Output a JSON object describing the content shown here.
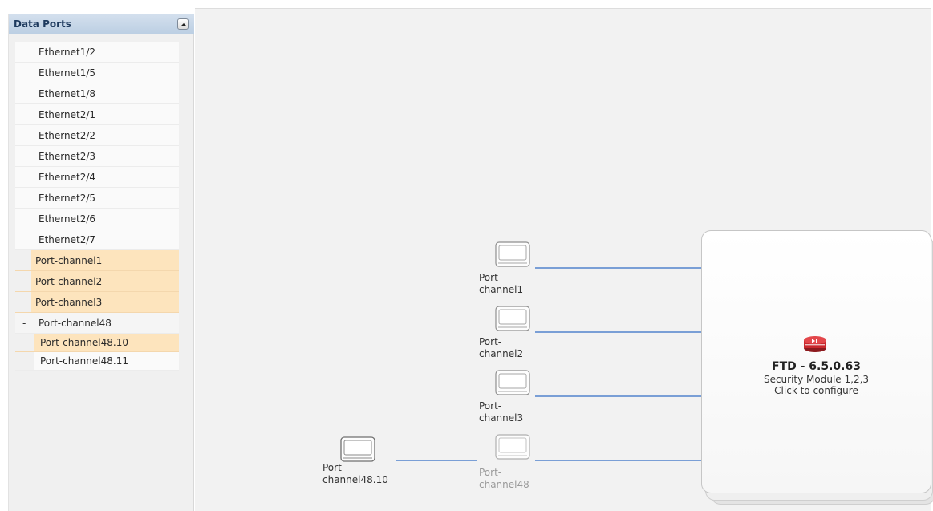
{
  "sidebar": {
    "title": "Data Ports",
    "items": [
      {
        "label": "Ethernet1/2"
      },
      {
        "label": "Ethernet1/5"
      },
      {
        "label": "Ethernet1/8"
      },
      {
        "label": "Ethernet2/1"
      },
      {
        "label": "Ethernet2/2"
      },
      {
        "label": "Ethernet2/3"
      },
      {
        "label": "Ethernet2/4"
      },
      {
        "label": "Ethernet2/5"
      },
      {
        "label": "Ethernet2/6"
      },
      {
        "label": "Ethernet2/7"
      },
      {
        "label": "Port-channel1"
      },
      {
        "label": "Port-channel2"
      },
      {
        "label": "Port-channel3"
      },
      {
        "label": "Port-channel48",
        "toggle": "-"
      },
      {
        "label": "Port-channel48.10"
      },
      {
        "label": "Port-channel48.11"
      }
    ]
  },
  "canvas": {
    "nodes": {
      "pc1": {
        "label": "Port-\nchannel1"
      },
      "pc2": {
        "label": "Port-\nchannel2"
      },
      "pc3": {
        "label": "Port-\nchannel3"
      },
      "pc48": {
        "label": "Port-\nchannel48"
      },
      "pc48_10": {
        "label": "Port-\nchannel48.10"
      }
    },
    "module": {
      "title": "FTD - 6.5.0.63",
      "subtitle": "Security Module 1,2,3",
      "action": "Click to configure"
    }
  },
  "colors": {
    "link": "#7a9fd6",
    "selected_port": "#fde4bd",
    "header": "#c8d8ea",
    "module_icon": "#c8282d"
  },
  "icons": {
    "collapse": "chevron-up-icon",
    "port": "port-channel-icon",
    "module": "security-module-icon"
  }
}
